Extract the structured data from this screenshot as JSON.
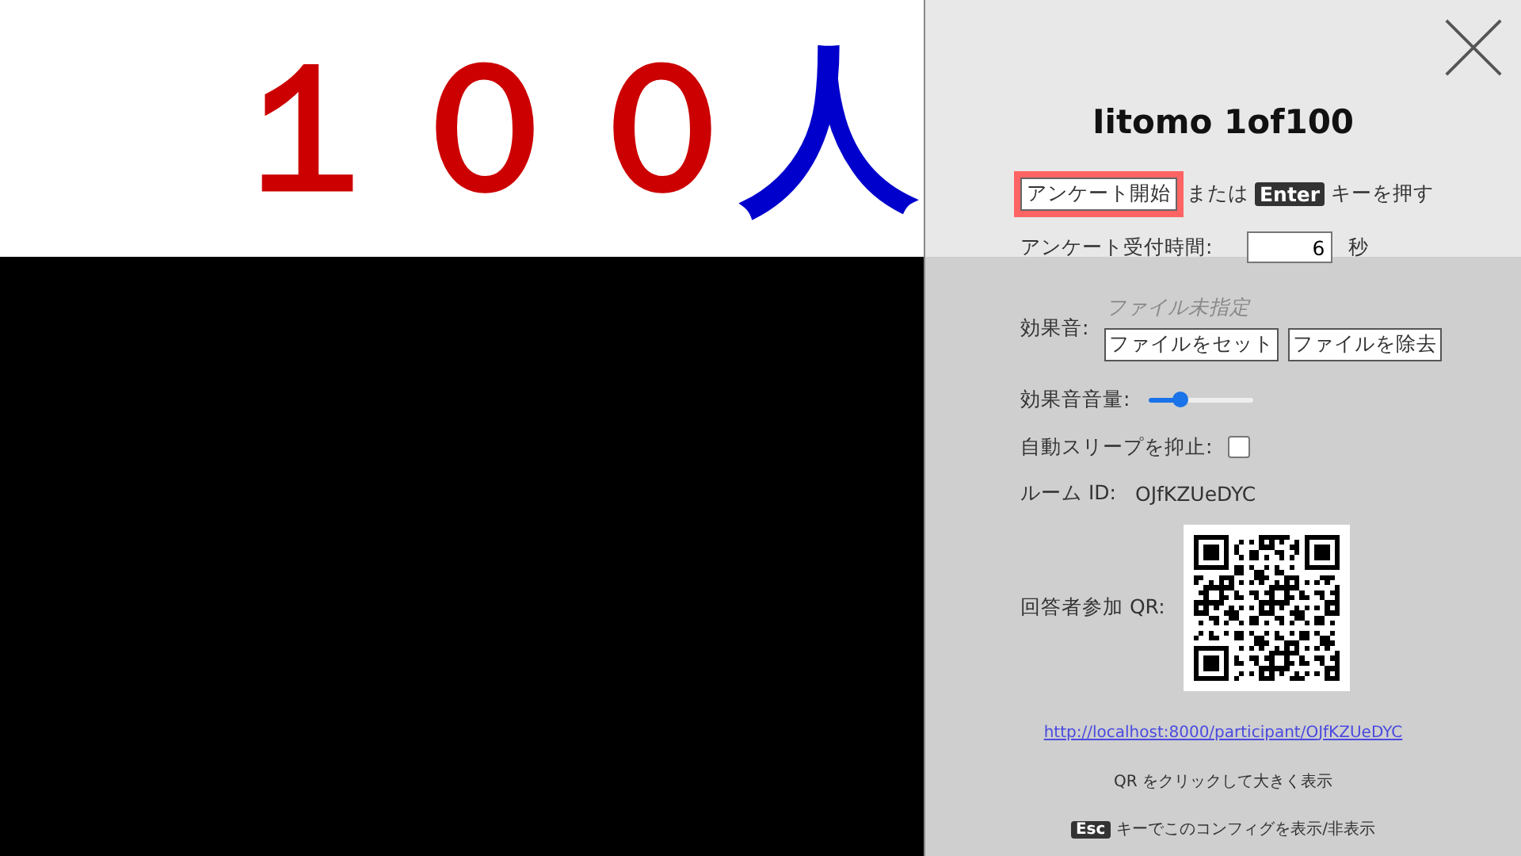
{
  "stage": {
    "headline": [
      {
        "text": "１００",
        "color": "#cc0000"
      },
      {
        "text": "人",
        "color": "#0000cc"
      }
    ]
  },
  "config_panel": {
    "title": "Iitomo 1of100",
    "start": {
      "button": "アンケート開始",
      "highlighted": true,
      "or": "または",
      "key": "Enter",
      "suffix": "キーを押す"
    },
    "duration": {
      "label": "アンケート受付時間:",
      "value": "6",
      "unit": "秒"
    },
    "sound": {
      "label": "効果音:",
      "file_status": "ファイル未指定",
      "buttons": [
        "ファイルをセット",
        "ファイルを除去"
      ]
    },
    "volume": {
      "label": "効果音音量:",
      "level": 0.3
    },
    "sleep": {
      "label": "自動スリープを抑止:",
      "checked": false
    },
    "room": {
      "label": "ルーム ID:",
      "id": "OJfKZUeDYC"
    },
    "qr": {
      "label": "回答者参加 QR:",
      "url": "http://localhost:8000/participant/OJfKZUeDYC",
      "hint": "QR をクリックして大きく表示"
    },
    "toggle_hint": {
      "key": "Esc",
      "text": "キーでこのコンフィグを表示/非表示"
    }
  }
}
